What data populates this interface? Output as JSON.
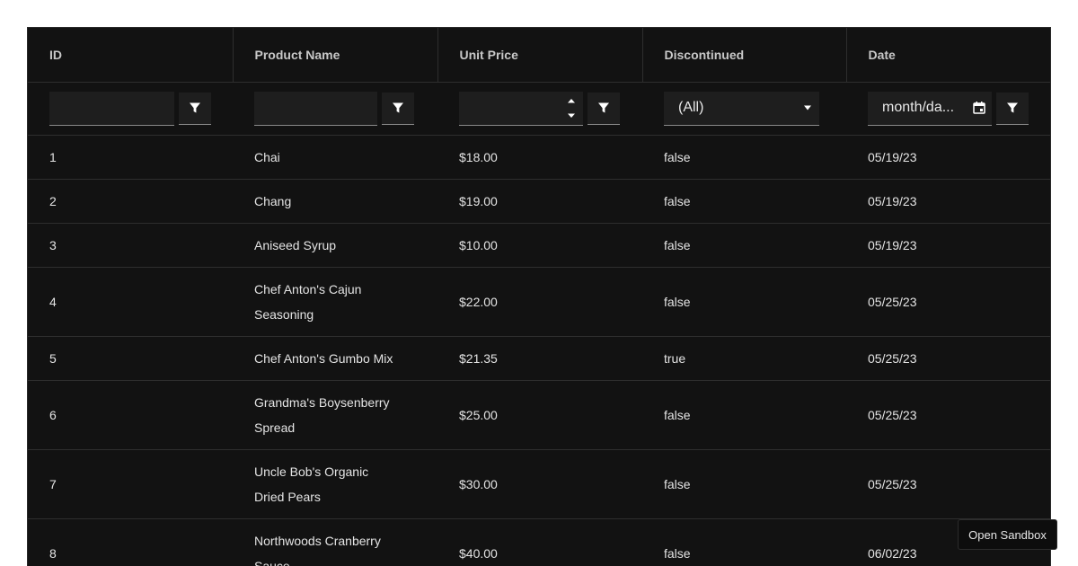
{
  "columns": [
    {
      "key": "id",
      "label": "ID"
    },
    {
      "key": "product_name",
      "label": "Product Name"
    },
    {
      "key": "unit_price",
      "label": "Unit Price"
    },
    {
      "key": "discontinued",
      "label": "Discontinued"
    },
    {
      "key": "date",
      "label": "Date"
    }
  ],
  "filters": {
    "id_value": "",
    "product_name_value": "",
    "unit_price_value": "",
    "discontinued_selected": "(All)",
    "date_placeholder": "month/da..."
  },
  "rows": [
    {
      "id": "1",
      "product_name": "Chai",
      "unit_price": "$18.00",
      "discontinued": "false",
      "date": "05/19/23"
    },
    {
      "id": "2",
      "product_name": "Chang",
      "unit_price": "$19.00",
      "discontinued": "false",
      "date": "05/19/23"
    },
    {
      "id": "3",
      "product_name": "Aniseed Syrup",
      "unit_price": "$10.00",
      "discontinued": "false",
      "date": "05/19/23"
    },
    {
      "id": "4",
      "product_name": "Chef Anton's Cajun Seasoning",
      "unit_price": "$22.00",
      "discontinued": "false",
      "date": "05/25/23"
    },
    {
      "id": "5",
      "product_name": "Chef Anton's Gumbo Mix",
      "unit_price": "$21.35",
      "discontinued": "true",
      "date": "05/25/23"
    },
    {
      "id": "6",
      "product_name": "Grandma's Boysenberry Spread",
      "unit_price": "$25.00",
      "discontinued": "false",
      "date": "05/25/23"
    },
    {
      "id": "7",
      "product_name": "Uncle Bob's Organic Dried Pears",
      "unit_price": "$30.00",
      "discontinued": "false",
      "date": "05/25/23"
    },
    {
      "id": "8",
      "product_name": "Northwoods Cranberry Sauce",
      "unit_price": "$40.00",
      "discontinued": "false",
      "date": "06/02/23"
    }
  ],
  "sandbox_button": {
    "label": "Open Sandbox"
  },
  "icons": {
    "filter": "filter-icon",
    "calendar": "calendar-icon",
    "dropdown": "caret-down-icon",
    "spin_up": "spin-up-icon",
    "spin_down": "spin-down-icon"
  },
  "colors": {
    "grid_background": "#121212",
    "input_background": "#1e1e1e",
    "border": "#2e2e2e",
    "text": "#e4e4e4",
    "header_text": "#c8c8c8"
  }
}
